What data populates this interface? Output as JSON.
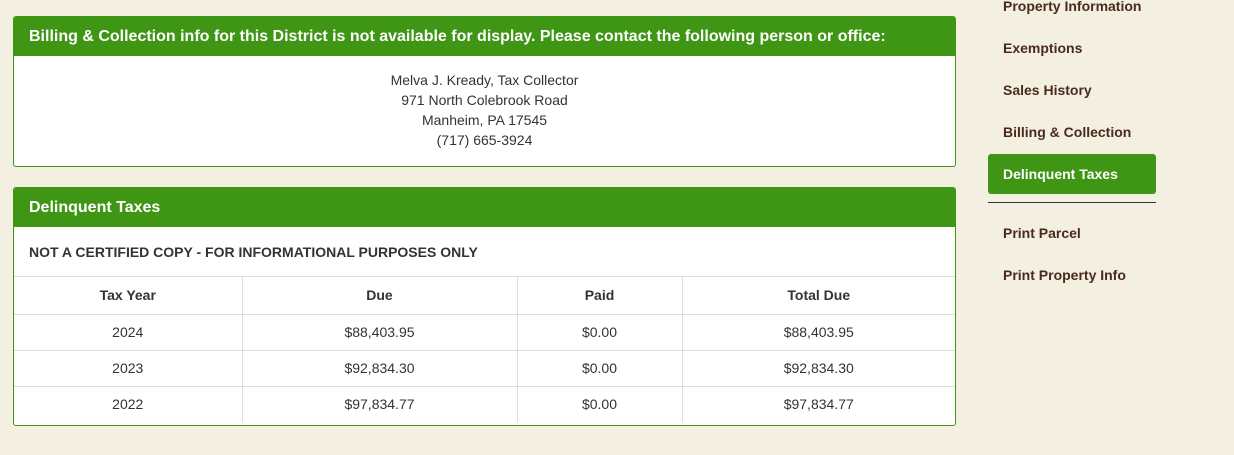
{
  "billing_panel": {
    "header": "Billing & Collection info for this District is not available for display. Please contact the following person or office:",
    "contact_lines": [
      "Melva J. Kready, Tax Collector",
      "971 North Colebrook Road",
      "Manheim, PA 17545",
      "(717) 665-3924"
    ]
  },
  "delinquent_panel": {
    "header": "Delinquent Taxes",
    "disclaimer": "NOT A CERTIFIED COPY - FOR INFORMATIONAL PURPOSES ONLY",
    "columns": [
      "Tax Year",
      "Due",
      "Paid",
      "Total Due"
    ],
    "rows": [
      [
        "2024",
        "$88,403.95",
        "$0.00",
        "$88,403.95"
      ],
      [
        "2023",
        "$92,834.30",
        "$0.00",
        "$92,834.30"
      ],
      [
        "2022",
        "$97,834.77",
        "$0.00",
        "$97,834.77"
      ]
    ]
  },
  "sidebar": {
    "items": [
      {
        "label": "Property Information",
        "active": false
      },
      {
        "label": "Exemptions",
        "active": false
      },
      {
        "label": "Sales History",
        "active": false
      },
      {
        "label": "Billing & Collection",
        "active": false
      },
      {
        "label": "Delinquent Taxes",
        "active": true
      }
    ],
    "secondary_items": [
      {
        "label": "Print Parcel"
      },
      {
        "label": "Print Property Info"
      }
    ]
  },
  "colors": {
    "accent_green": "#3f9614",
    "page_background": "#f3efe1",
    "nav_text": "#4a2a1c"
  }
}
